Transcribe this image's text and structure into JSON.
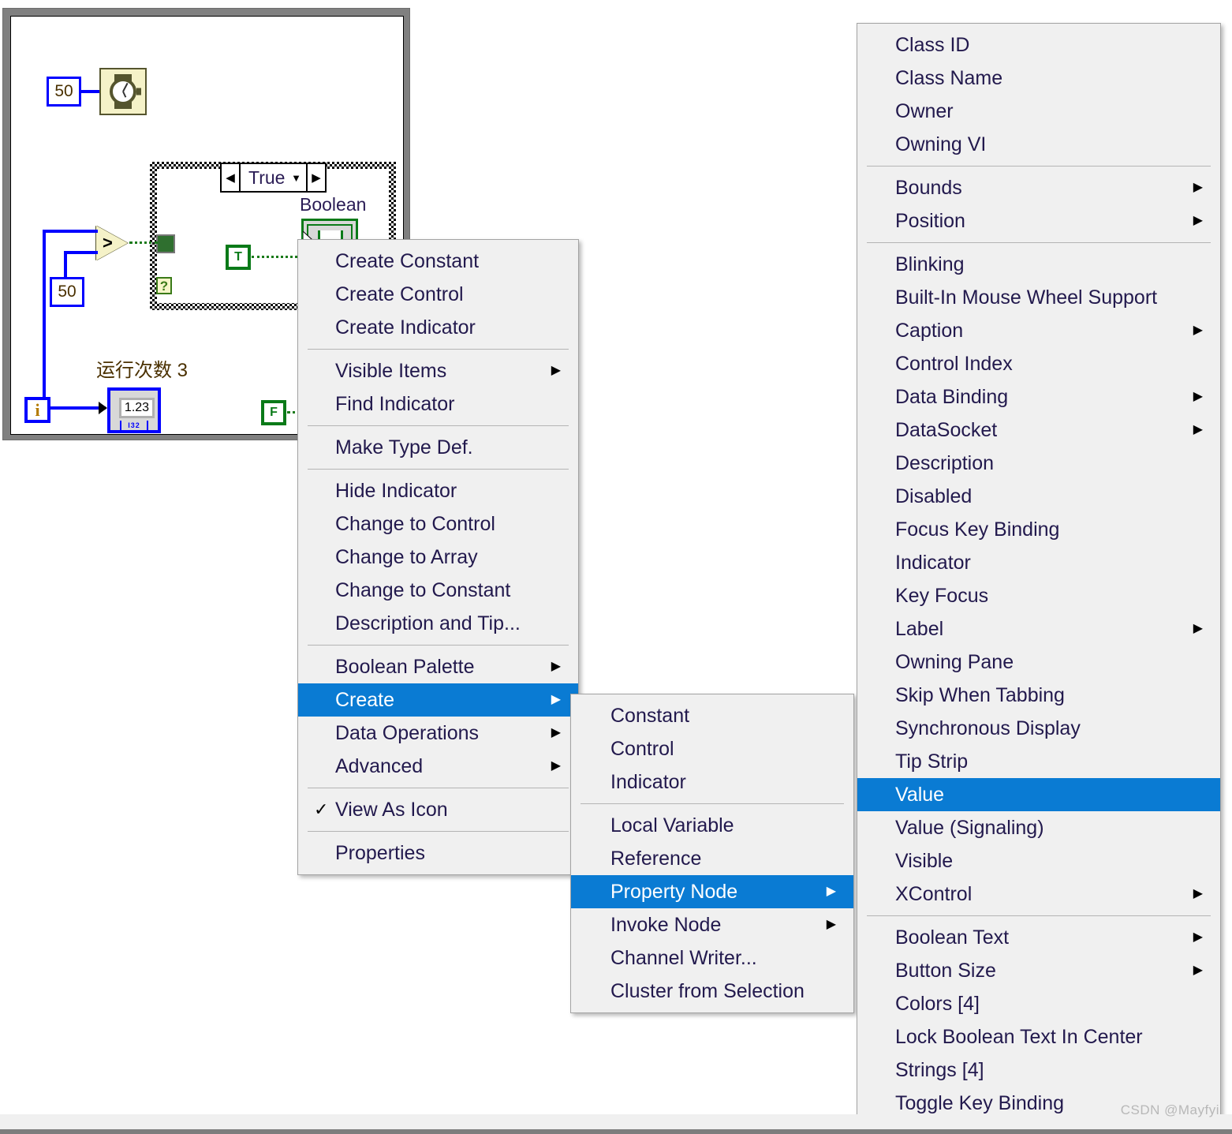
{
  "block_diagram": {
    "wait_constant": "50",
    "compare_constant": "50",
    "timer_icon": "wristwatch-icon",
    "case_selector": {
      "value": "True",
      "left_arrow": "◀",
      "right_arrow": "▶",
      "caret": "▼"
    },
    "boolean_label": "Boolean",
    "boolean_constant": "T",
    "boolean_constant_false": "F",
    "tunnel_question": "?",
    "loop_index": "i",
    "run_count_label": "运行次数 3",
    "numeric_value": "1.23",
    "numeric_type": "I32",
    "comparison_glyph": ">"
  },
  "menus": {
    "context_menu": {
      "name": "Boolean indicator context menu",
      "items": [
        {
          "label": "Create Constant",
          "submenu": false,
          "selected": false
        },
        {
          "label": "Create Control",
          "submenu": false,
          "selected": false
        },
        {
          "label": "Create Indicator",
          "submenu": false,
          "selected": false
        },
        {
          "separator": true
        },
        {
          "label": "Visible Items",
          "submenu": true,
          "selected": false
        },
        {
          "label": "Find Indicator",
          "submenu": false,
          "selected": false
        },
        {
          "separator": true
        },
        {
          "label": "Make Type Def.",
          "submenu": false,
          "selected": false
        },
        {
          "separator": true
        },
        {
          "label": "Hide Indicator",
          "submenu": false,
          "selected": false
        },
        {
          "label": "Change to Control",
          "submenu": false,
          "selected": false
        },
        {
          "label": "Change to Array",
          "submenu": false,
          "selected": false
        },
        {
          "label": "Change to Constant",
          "submenu": false,
          "selected": false
        },
        {
          "label": "Description and Tip...",
          "submenu": false,
          "selected": false
        },
        {
          "separator": true
        },
        {
          "label": "Boolean Palette",
          "submenu": true,
          "selected": false
        },
        {
          "label": "Create",
          "submenu": true,
          "selected": true
        },
        {
          "label": "Data Operations",
          "submenu": true,
          "selected": false
        },
        {
          "label": "Advanced",
          "submenu": true,
          "selected": false
        },
        {
          "separator": true
        },
        {
          "label": "View As Icon",
          "submenu": false,
          "selected": false,
          "checked": true
        },
        {
          "separator": true
        },
        {
          "label": "Properties",
          "submenu": false,
          "selected": false
        }
      ]
    },
    "create_submenu": {
      "name": "Create submenu",
      "items": [
        {
          "label": "Constant",
          "submenu": false,
          "selected": false
        },
        {
          "label": "Control",
          "submenu": false,
          "selected": false
        },
        {
          "label": "Indicator",
          "submenu": false,
          "selected": false
        },
        {
          "separator": true
        },
        {
          "label": "Local Variable",
          "submenu": false,
          "selected": false
        },
        {
          "label": "Reference",
          "submenu": false,
          "selected": false
        },
        {
          "label": "Property Node",
          "submenu": true,
          "selected": true
        },
        {
          "label": "Invoke Node",
          "submenu": true,
          "selected": false
        },
        {
          "label": "Channel Writer...",
          "submenu": false,
          "selected": false
        },
        {
          "label": "Cluster from Selection",
          "submenu": false,
          "selected": false
        }
      ]
    },
    "property_node_submenu": {
      "name": "Property Node submenu",
      "items": [
        {
          "label": "Class ID",
          "submenu": false,
          "selected": false
        },
        {
          "label": "Class Name",
          "submenu": false,
          "selected": false
        },
        {
          "label": "Owner",
          "submenu": false,
          "selected": false
        },
        {
          "label": "Owning VI",
          "submenu": false,
          "selected": false
        },
        {
          "separator": true
        },
        {
          "label": "Bounds",
          "submenu": true,
          "selected": false
        },
        {
          "label": "Position",
          "submenu": true,
          "selected": false
        },
        {
          "separator": true
        },
        {
          "label": "Blinking",
          "submenu": false,
          "selected": false
        },
        {
          "label": "Built-In Mouse Wheel Support",
          "submenu": false,
          "selected": false
        },
        {
          "label": "Caption",
          "submenu": true,
          "selected": false
        },
        {
          "label": "Control Index",
          "submenu": false,
          "selected": false
        },
        {
          "label": "Data Binding",
          "submenu": true,
          "selected": false
        },
        {
          "label": "DataSocket",
          "submenu": true,
          "selected": false
        },
        {
          "label": "Description",
          "submenu": false,
          "selected": false
        },
        {
          "label": "Disabled",
          "submenu": false,
          "selected": false
        },
        {
          "label": "Focus Key Binding",
          "submenu": false,
          "selected": false
        },
        {
          "label": "Indicator",
          "submenu": false,
          "selected": false
        },
        {
          "label": "Key Focus",
          "submenu": false,
          "selected": false
        },
        {
          "label": "Label",
          "submenu": true,
          "selected": false
        },
        {
          "label": "Owning Pane",
          "submenu": false,
          "selected": false
        },
        {
          "label": "Skip When Tabbing",
          "submenu": false,
          "selected": false
        },
        {
          "label": "Synchronous Display",
          "submenu": false,
          "selected": false
        },
        {
          "label": "Tip Strip",
          "submenu": false,
          "selected": false
        },
        {
          "label": "Value",
          "submenu": false,
          "selected": true
        },
        {
          "label": "Value (Signaling)",
          "submenu": false,
          "selected": false
        },
        {
          "label": "Visible",
          "submenu": false,
          "selected": false
        },
        {
          "label": "XControl",
          "submenu": true,
          "selected": false
        },
        {
          "separator": true
        },
        {
          "label": "Boolean Text",
          "submenu": true,
          "selected": false
        },
        {
          "label": "Button Size",
          "submenu": true,
          "selected": false
        },
        {
          "label": "Colors [4]",
          "submenu": false,
          "selected": false
        },
        {
          "label": "Lock Boolean Text In Center",
          "submenu": false,
          "selected": false
        },
        {
          "label": "Strings [4]",
          "submenu": false,
          "selected": false
        },
        {
          "label": "Toggle Key Binding",
          "submenu": false,
          "selected": false
        }
      ]
    }
  },
  "watermark": "CSDN @Mayfyi",
  "colors": {
    "highlight": "#0a7bd3",
    "menu_bg": "#f0f0f0",
    "menu_text": "#22194d",
    "wire_blue": "#0000ff",
    "boolean_green": "#0a7a18",
    "icon_yellow": "#f5f2c8"
  }
}
